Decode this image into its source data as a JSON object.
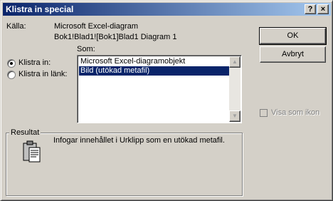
{
  "window": {
    "title": "Klistra in special",
    "help_button": "?",
    "close_button": "×"
  },
  "source": {
    "label": "Källa:",
    "line1": "Microsoft Excel-diagram",
    "line2": "Bok1!Blad1![Bok1]Blad1 Diagram 1"
  },
  "as_label": "Som:",
  "options": {
    "paste": {
      "label": "Klistra in:",
      "checked": true
    },
    "paste_link": {
      "label": "Klistra in länk:",
      "checked": false
    }
  },
  "formats": [
    {
      "label": "Microsoft Excel-diagramobjekt",
      "selected": false
    },
    {
      "label": "Bild (utökad metafil)",
      "selected": true
    }
  ],
  "buttons": {
    "ok": "OK",
    "cancel": "Avbryt"
  },
  "show_as_icon": {
    "label": "Visa som ikon",
    "checked": false,
    "enabled": false
  },
  "result": {
    "label": "Resultat",
    "text": "Infogar innehållet i Urklipp som en utökad metafil."
  },
  "colors": {
    "title_start": "#0a246a",
    "title_end": "#a6caf0",
    "selection": "#0a246a"
  }
}
